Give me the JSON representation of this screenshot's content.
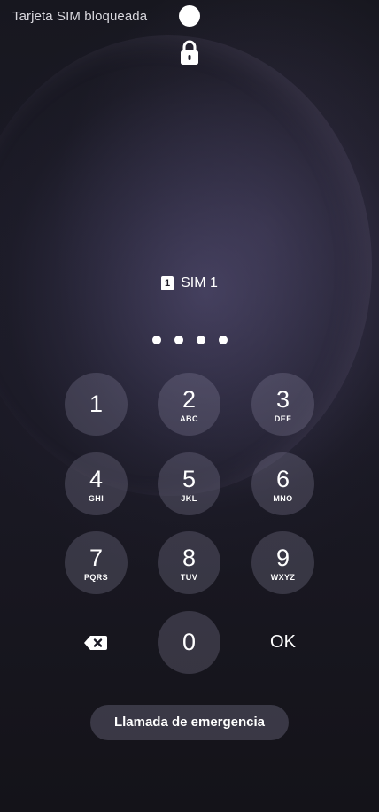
{
  "status_bar": {
    "text": "Tarjeta SIM bloqueada"
  },
  "sim": {
    "badge": "1",
    "label": "SIM 1"
  },
  "pin_entry": {
    "digits_entered": 4
  },
  "keypad": {
    "keys": [
      {
        "digit": "1",
        "letters": ""
      },
      {
        "digit": "2",
        "letters": "ABC"
      },
      {
        "digit": "3",
        "letters": "DEF"
      },
      {
        "digit": "4",
        "letters": "GHI"
      },
      {
        "digit": "5",
        "letters": "JKL"
      },
      {
        "digit": "6",
        "letters": "MNO"
      },
      {
        "digit": "7",
        "letters": "PQRS"
      },
      {
        "digit": "8",
        "letters": "TUV"
      },
      {
        "digit": "9",
        "letters": "WXYZ"
      },
      {
        "digit": "0",
        "letters": ""
      }
    ],
    "ok_label": "OK",
    "backspace_icon": "backspace-icon"
  },
  "emergency_call": {
    "label": "Llamada de emergencia"
  },
  "icons": {
    "lock": "lock-icon",
    "status_dot": "camera-dot"
  },
  "colors": {
    "background": "#1a1924",
    "key_fill": "#4a4858",
    "text": "#ffffff"
  }
}
